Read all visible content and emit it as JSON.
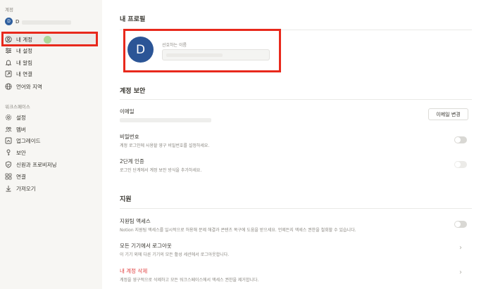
{
  "sidebar": {
    "account_section": "계정",
    "user": {
      "avatar_letter": "D",
      "name": "D"
    },
    "account_items": [
      {
        "label": "내 계정",
        "icon": "user-circle-icon"
      },
      {
        "label": "내 설정",
        "icon": "sliders-icon"
      },
      {
        "label": "내 알림",
        "icon": "bell-icon"
      },
      {
        "label": "내 연결",
        "icon": "external-link-icon"
      },
      {
        "label": "언어와 지역",
        "icon": "globe-icon"
      }
    ],
    "workspace_section": "워크스페이스",
    "workspace_items": [
      {
        "label": "설정",
        "icon": "gear-icon"
      },
      {
        "label": "멤버",
        "icon": "people-icon"
      },
      {
        "label": "업그레이드",
        "icon": "upgrade-icon"
      },
      {
        "label": "보안",
        "icon": "key-icon"
      },
      {
        "label": "신원과 프로비저닝",
        "icon": "shield-check-icon"
      },
      {
        "label": "연결",
        "icon": "grid-icon"
      },
      {
        "label": "가져오기",
        "icon": "download-icon"
      }
    ]
  },
  "profile": {
    "title": "내 프로필",
    "avatar_letter": "D",
    "preferred_name_label": "선호하는 이름"
  },
  "security": {
    "title": "계정 보안",
    "email_label": "이메일",
    "change_email_button": "이메일 변경",
    "password_label": "비밀번호",
    "password_desc": "계정 로그인에 사용할 영구 비밀번호를 설정하세요.",
    "two_step_label": "2단계 인증",
    "two_step_desc": "로그인 단계에서 계정 보안 방식을 추가하세요."
  },
  "support": {
    "title": "지원",
    "access_label": "지원팀 액세스",
    "access_desc": "Notion 지원팀 액세스를 일시적으로 허용해 문제 해결과 콘텐츠 복구에 도움을 받으세요. 언제든지 액세스 권한을 철회할 수 있습니다.",
    "logout_label": "모든 기기에서 로그아웃",
    "logout_desc": "이 기기 외에 다른 기기의 모든 활성 세션에서 로그아웃합니다.",
    "delete_label": "내 계정 삭제",
    "delete_desc": "계정을 영구적으로 삭제하고 모든 워크스페이스에서 액세스 권한을 제거합니다."
  },
  "colors": {
    "highlight": "#e8291c",
    "avatar": "#2b5596",
    "danger": "#e03e3e"
  }
}
